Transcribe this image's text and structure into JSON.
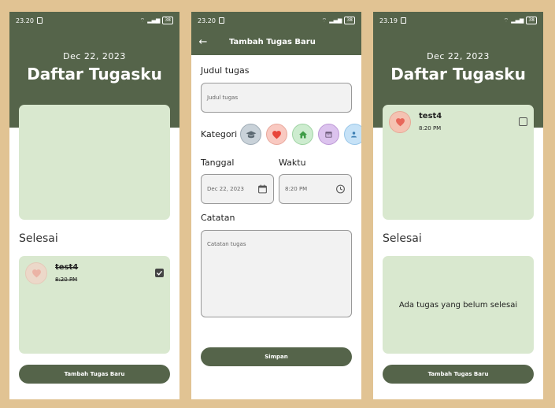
{
  "screen1": {
    "status": {
      "time": "23.20",
      "battery": "38"
    },
    "header": {
      "date": "Dec 22, 2023",
      "title": "Daftar Tugasku"
    },
    "done_section_label": "Selesai",
    "done_task": {
      "name": "test4",
      "time": "8:20 PM",
      "checked": true
    },
    "add_button": "Tambah Tugas Baru"
  },
  "screen2": {
    "status": {
      "time": "23.20",
      "battery": "38"
    },
    "appbar": {
      "title": "Tambah Tugas Baru",
      "back_icon": "arrow-back-icon"
    },
    "title_label": "Judul tugas",
    "title_placeholder": "Judul tugas",
    "category_label": "Kategori",
    "categories": [
      {
        "icon": "graduation-cap-icon",
        "color": "#c9d2d9"
      },
      {
        "icon": "heart-icon",
        "color": "#f9c9c1"
      },
      {
        "icon": "home-icon",
        "color": "#cdeccf"
      },
      {
        "icon": "calendar-icon",
        "color": "#dcc3ee"
      },
      {
        "icon": "people-icon",
        "color": "#c6e2f7"
      }
    ],
    "date_label": "Tanggal",
    "date_value": "Dec 22, 2023",
    "time_label": "Waktu",
    "time_value": "8:20 PM",
    "notes_label": "Catatan",
    "notes_placeholder": "Catatan tugas",
    "save_button": "Simpan"
  },
  "screen3": {
    "status": {
      "time": "23.19",
      "battery": "38"
    },
    "header": {
      "date": "Dec 22, 2023",
      "title": "Daftar Tugasku"
    },
    "pending_task": {
      "name": "test4",
      "time": "8:20 PM",
      "checked": false
    },
    "done_section_label": "Selesai",
    "empty_message": "Ada tugas yang belum selesai",
    "add_button": "Tambah Tugas Baru"
  },
  "colors": {
    "primary": "#55644a",
    "card": "#d9e8cf",
    "background": "#e1c393",
    "heart": "#e8675a"
  }
}
